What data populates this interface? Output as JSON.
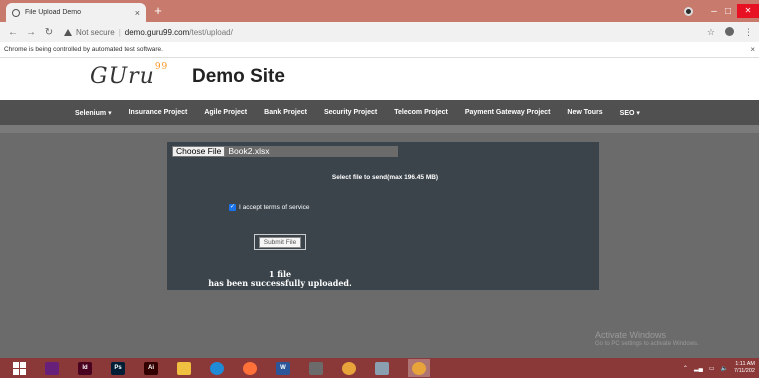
{
  "browser": {
    "tab_title": "File Upload Demo",
    "tab_close": "×",
    "new_tab": "+",
    "not_secure": "Not secure",
    "separator": "|",
    "host": "demo.guru99.com",
    "path": "/test/upload/",
    "infobar_text": "Chrome is being controlled by automated test software.",
    "infobar_close": "×",
    "window_controls": {
      "minimize": "–",
      "maximize": "□",
      "close": "✕"
    }
  },
  "site": {
    "logo_text": "GUru",
    "logo_sup": "99",
    "title": "Demo Site"
  },
  "nav": {
    "items": [
      "Selenium ▾",
      "Insurance Project",
      "Agile Project",
      "Bank Project",
      "Security Project",
      "Telecom Project",
      "Payment Gateway Project",
      "New Tours",
      "SEO ▾"
    ]
  },
  "upload": {
    "choose_label": "Choose File",
    "file_name": "Book2.xlsx",
    "max_label": "Select file to send(max 196.45 MB)",
    "terms_label": "I accept terms of service",
    "terms_checked": true,
    "submit_label": "Submit File",
    "success_line1": "1 file",
    "success_line2": "has been successfully uploaded."
  },
  "watermark": {
    "line1": "Activate Windows",
    "line2": "Go to PC settings to activate Windows."
  },
  "taskbar": {
    "apps": [
      {
        "name": "windows-start-icon",
        "label": "",
        "color": "#ffffff"
      },
      {
        "name": "visual-studio-icon",
        "label": "",
        "color": "#68217a"
      },
      {
        "name": "indesign-icon",
        "label": "Id",
        "color": "#49021f"
      },
      {
        "name": "photoshop-icon",
        "label": "Ps",
        "color": "#001e36"
      },
      {
        "name": "illustrator-icon",
        "label": "Ai",
        "color": "#330000"
      },
      {
        "name": "file-explorer-icon",
        "label": "",
        "color": "#f0c040"
      },
      {
        "name": "edge-icon",
        "label": "",
        "color": "#1f8ad6"
      },
      {
        "name": "firefox-icon",
        "label": "",
        "color": "#ff7139"
      },
      {
        "name": "word-icon",
        "label": "W",
        "color": "#2b579a"
      },
      {
        "name": "settings-app-icon",
        "label": "",
        "color": "#6b6b6b"
      },
      {
        "name": "chrome-icon",
        "label": "",
        "color": "#e8a33a"
      },
      {
        "name": "tool-app-icon",
        "label": "",
        "color": "#8aa0b0"
      },
      {
        "name": "chrome-active-icon",
        "label": "",
        "color": "#e8a33a"
      }
    ],
    "time": "1:11 AM",
    "date": "7/11/202"
  }
}
